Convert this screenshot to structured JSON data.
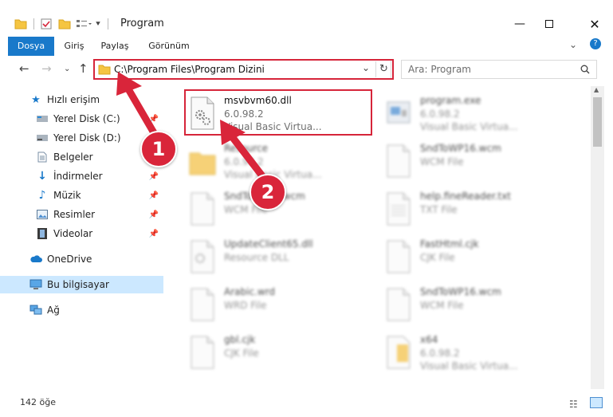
{
  "window": {
    "title": "Program"
  },
  "ribbon": {
    "tabs": [
      "Dosya",
      "Giriş",
      "Paylaş",
      "Görünüm"
    ]
  },
  "address": {
    "path": "C:\\Program Files\\Program Dizini"
  },
  "search": {
    "placeholder": "Ara: Program"
  },
  "sidebar": {
    "items": [
      {
        "label": "Hızlı erişim",
        "icon": "star-icon"
      },
      {
        "label": "Yerel Disk (C:)",
        "icon": "drive-icon"
      },
      {
        "label": "Yerel Disk (D:)",
        "icon": "drive-icon"
      },
      {
        "label": "Belgeler",
        "icon": "document-icon"
      },
      {
        "label": "İndirmeler",
        "icon": "download-icon"
      },
      {
        "label": "Müzik",
        "icon": "music-icon"
      },
      {
        "label": "Resimler",
        "icon": "pictures-icon"
      },
      {
        "label": "Videolar",
        "icon": "video-icon"
      },
      {
        "label": "OneDrive",
        "icon": "cloud-icon"
      },
      {
        "label": "Bu bilgisayar",
        "icon": "computer-icon"
      },
      {
        "label": "Ağ",
        "icon": "network-icon"
      }
    ]
  },
  "files": [
    {
      "name": "msvbvm60.dll",
      "line2": "6.0.98.2",
      "line3": "Visual Basic Virtua..."
    },
    {
      "name": "program.exe",
      "line2": "6.0.98.2",
      "line3": "Visual Basic Virtua..."
    },
    {
      "name": "Resource",
      "line2": "6.0.98.2",
      "line3": "Visual Basic Virtua..."
    },
    {
      "name": "SndToWP16.wcm",
      "line2": "WCM File",
      "line3": ""
    },
    {
      "name": "SndToWP16.wcm",
      "line2": "WCM File",
      "line3": ""
    },
    {
      "name": "help.fineReader.txt",
      "line2": "TXT File",
      "line3": ""
    },
    {
      "name": "UpdateClient65.dll",
      "line2": "Resource DLL",
      "line3": ""
    },
    {
      "name": "FastHtml.cjk",
      "line2": "CJK File",
      "line3": ""
    },
    {
      "name": "Arabic.wrd",
      "line2": "WRD File",
      "line3": ""
    },
    {
      "name": "SndToWP16.wcm",
      "line2": "WCM File",
      "line3": ""
    },
    {
      "name": "gbl.cjk",
      "line2": "CJK File",
      "line3": ""
    },
    {
      "name": "x64",
      "line2": "6.0.98.2",
      "line3": "Visual Basic Virtua..."
    }
  ],
  "status": {
    "count": "142 öğe"
  },
  "annotations": {
    "step1": "1",
    "step2": "2"
  },
  "colors": {
    "accent": "#1979ca",
    "highlight": "#d6253a",
    "selection": "#cce8ff"
  }
}
